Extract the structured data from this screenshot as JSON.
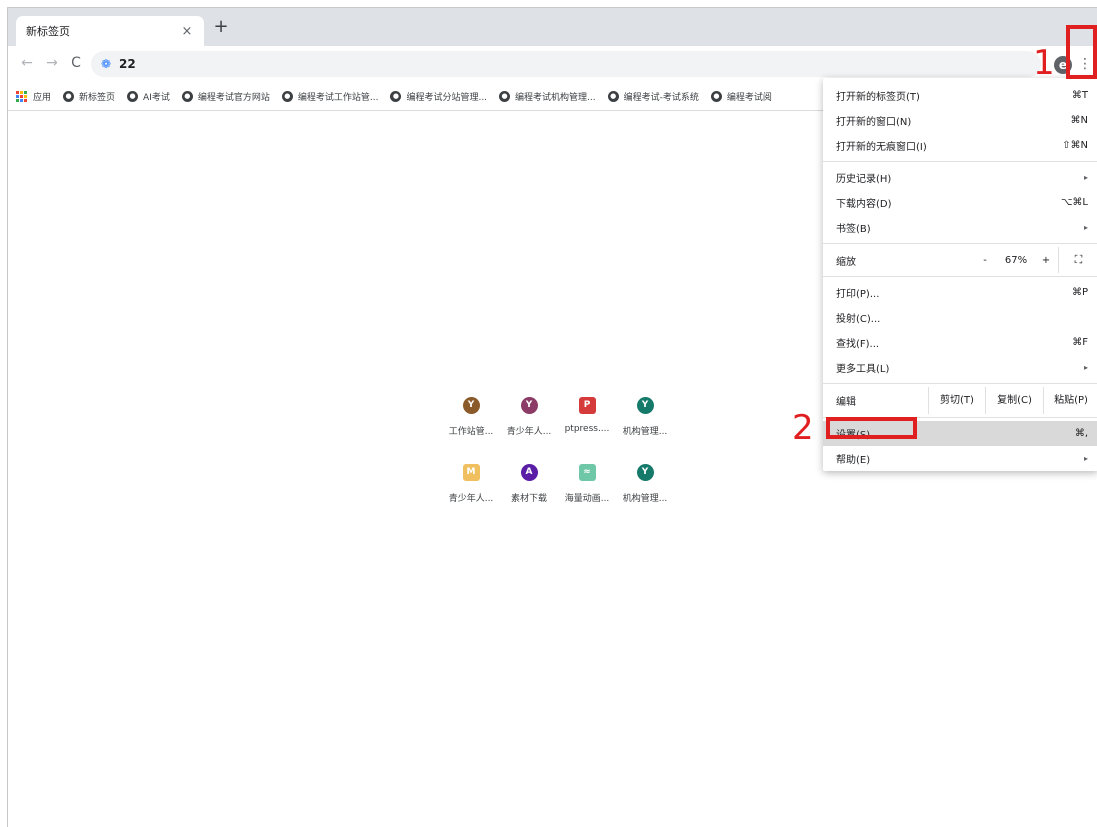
{
  "tab": {
    "title": "新标签页",
    "close": "×",
    "new_tab": "+"
  },
  "toolbar": {
    "back": "←",
    "forward": "→",
    "reload": "C",
    "address": "22",
    "profile_initial": "e",
    "menu": "⋮"
  },
  "bookmarks": {
    "apps_label": "应用",
    "items": [
      "新标签页",
      "AI考试",
      "编程考试官方网站",
      "编程考试工作站管...",
      "编程考试分站管理...",
      "编程考试机构管理...",
      "编程考试-考试系统",
      "编程考试阅"
    ]
  },
  "shortcuts": [
    {
      "label": "工作站管...",
      "glyph": "Y",
      "color": "#8a5a2b"
    },
    {
      "label": "青少年人...",
      "glyph": "Y",
      "color": "#8c3b66"
    },
    {
      "label": "ptpress....",
      "glyph": "P",
      "color": "#d63b3b"
    },
    {
      "label": "机构管理...",
      "glyph": "Y",
      "color": "#167a6b"
    },
    {
      "label": "青少年人...",
      "glyph": "M",
      "color": "#f0c060"
    },
    {
      "label": "素材下载",
      "glyph": "A",
      "color": "#5a1ea6"
    },
    {
      "label": "海量动画...",
      "glyph": "≈",
      "color": "#6ec7a6"
    },
    {
      "label": "机构管理...",
      "glyph": "Y",
      "color": "#167a6b"
    }
  ],
  "menu": {
    "new_tab": {
      "label": "打开新的标签页(T)",
      "shortcut": "⌘T"
    },
    "new_window": {
      "label": "打开新的窗口(N)",
      "shortcut": "⌘N"
    },
    "incognito": {
      "label": "打开新的无痕窗口(I)",
      "shortcut": "⇧⌘N"
    },
    "history": {
      "label": "历史记录(H)",
      "arrow": "▸"
    },
    "downloads": {
      "label": "下载内容(D)",
      "shortcut": "⌥⌘L"
    },
    "bookmarks": {
      "label": "书签(B)",
      "arrow": "▸"
    },
    "zoom": {
      "label": "缩放",
      "minus": "-",
      "value": "67%",
      "plus": "+",
      "fullscreen": "⛶"
    },
    "print": {
      "label": "打印(P)...",
      "shortcut": "⌘P"
    },
    "cast": {
      "label": "投射(C)..."
    },
    "find": {
      "label": "查找(F)...",
      "shortcut": "⌘F"
    },
    "more_tools": {
      "label": "更多工具(L)",
      "arrow": "▸"
    },
    "edit": {
      "label": "编辑",
      "cut": "剪切(T)",
      "copy": "复制(C)",
      "paste": "粘贴(P)"
    },
    "settings": {
      "label": "设置(S)",
      "shortcut": "⌘,"
    },
    "help": {
      "label": "帮助(E)",
      "arrow": "▸"
    }
  },
  "annotations": {
    "step1": "1",
    "step2": "2",
    "color": "#e02020"
  }
}
